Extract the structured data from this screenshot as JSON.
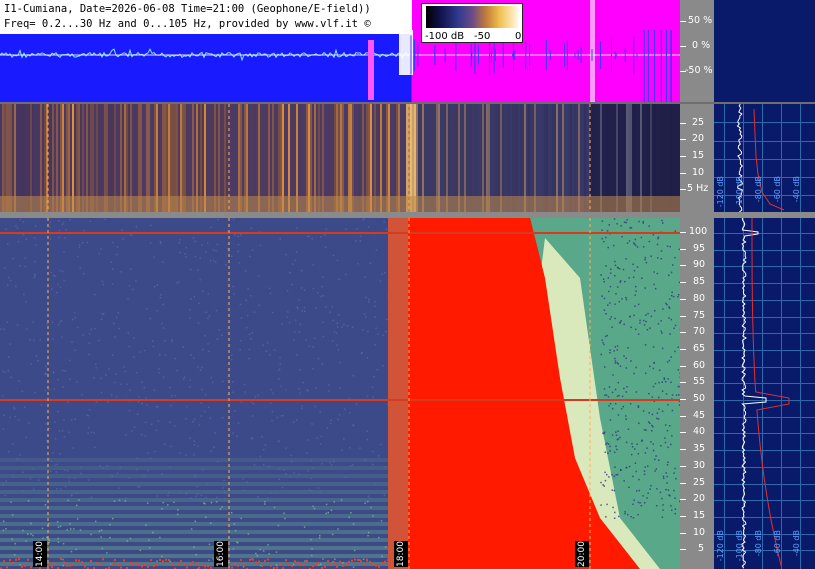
{
  "header": {
    "line1": "I1-Cumiana, Date=2026-06-08 Time=21:00 (Geophone/E-field))",
    "line2": "Freq= 0.2...30 Hz and 0...105 Hz, provided by www.vlf.it ©"
  },
  "colorbar": {
    "min_label": "-100 dB",
    "mid_label": "-50",
    "max_label": "0"
  },
  "wave_scale": [
    "50 %",
    "0 %",
    "-50 %"
  ],
  "spec1_scale": [
    "25",
    "20",
    "15",
    "10",
    "5 Hz"
  ],
  "spec2_scale": [
    "100",
    "95",
    "90",
    "85",
    "80",
    "75",
    "70",
    "65",
    "60",
    "55",
    "50",
    "45",
    "40",
    "35",
    "30",
    "25",
    "20",
    "15",
    "10",
    "5"
  ],
  "time_labels": [
    "14:00",
    "16:00",
    "18:00",
    "20:00"
  ],
  "profile_db_labels": [
    "-120 dB",
    "-100 dB",
    "-80 dB",
    "-60 dB",
    "-40 dB",
    "-20 dB"
  ],
  "colors": {
    "accent_red": "#ff1a00",
    "wave_blue": "#1a1aff",
    "wave_magenta": "#ff00ff",
    "panel_navy": "#0a1a6a"
  }
}
